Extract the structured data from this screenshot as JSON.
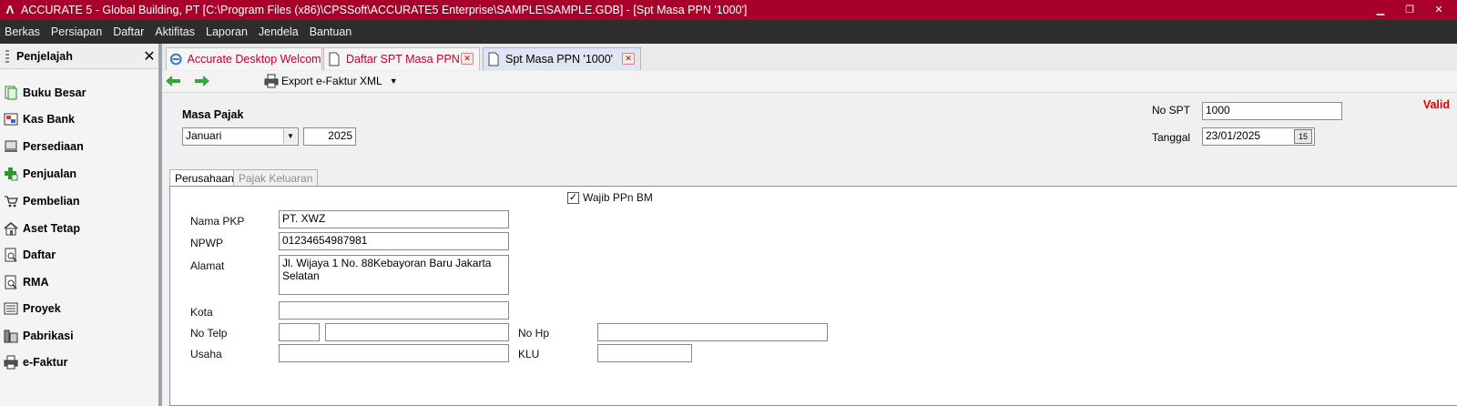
{
  "window": {
    "title": "ACCURATE 5  - Global Building, PT  [C:\\Program Files (x86)\\CPSSoft\\ACCURATE5 Enterprise\\SAMPLE\\SAMPLE.GDB] - [Spt Masa PPN '1000']"
  },
  "menu": {
    "items": [
      "Berkas",
      "Persiapan",
      "Daftar",
      "Aktifitas",
      "Laporan",
      "Jendela",
      "Bantuan"
    ]
  },
  "sidebar": {
    "title": "Penjelajah",
    "items": [
      {
        "label": "Buku Besar",
        "icon": "ledger-icon"
      },
      {
        "label": "Kas Bank",
        "icon": "cash-bank-icon"
      },
      {
        "label": "Persediaan",
        "icon": "inventory-icon"
      },
      {
        "label": "Penjualan",
        "icon": "sales-icon"
      },
      {
        "label": "Pembelian",
        "icon": "cart-icon"
      },
      {
        "label": "Aset Tetap",
        "icon": "house-icon"
      },
      {
        "label": "Daftar",
        "icon": "list-icon"
      },
      {
        "label": "RMA",
        "icon": "rma-icon"
      },
      {
        "label": "Proyek",
        "icon": "project-icon"
      },
      {
        "label": "Pabrikasi",
        "icon": "factory-icon"
      },
      {
        "label": "e-Faktur",
        "icon": "printer-icon"
      }
    ]
  },
  "tabs": [
    {
      "label": "Accurate Desktop Welcome..."
    },
    {
      "label": "Daftar SPT Masa PPN ..."
    },
    {
      "label": "Spt Masa PPN '1000'"
    }
  ],
  "toolbar": {
    "export_label": "Export e-Faktur XML"
  },
  "form": {
    "masa_pajak_label": "Masa Pajak",
    "month_value": "Januari",
    "year_value": "2025",
    "no_spt_label": "No SPT",
    "no_spt_value": "1000",
    "tanggal_label": "Tanggal",
    "tanggal_value": "23/01/2025",
    "status": "Valid"
  },
  "inner_tabs": {
    "perusahaan": "Perusahaan",
    "pajak_keluaran": "Pajak Keluaran"
  },
  "company": {
    "wajib_label": "Wajib PPn BM",
    "wajib_checked": true,
    "nama_pkp_label": "Nama PKP",
    "nama_pkp_value": "PT. XWZ",
    "npwp_label": "NPWP",
    "npwp_value": "01234654987981",
    "alamat_label": "Alamat",
    "alamat_value": "Jl. Wijaya 1 No. 88Kebayoran Baru Jakarta Selatan",
    "kota_label": "Kota",
    "kota_value": "",
    "no_telp_label": "No Telp",
    "no_telp_code": "",
    "no_telp_value": "",
    "no_hp_label": "No Hp",
    "no_hp_value": "",
    "usaha_label": "Usaha",
    "usaha_value": "",
    "klu_label": "KLU",
    "klu_value": ""
  }
}
